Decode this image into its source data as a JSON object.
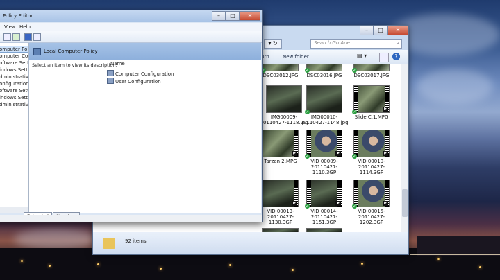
{
  "desktop": {},
  "explorer": {
    "search_placeholder": "Search Go Ape",
    "toolbar": {
      "burn_label": "urn",
      "new_folder_label": "New folder"
    },
    "caption": {
      "minimize": "–",
      "maximize": "□",
      "close": "✕"
    },
    "refresh_glyph": "▾ ↻",
    "search_glyph": "⌕",
    "view_glyph": "▤ ▾",
    "help_glyph": "?",
    "files": [
      {
        "label": "DSC03012.JPG",
        "thumb": "photo"
      },
      {
        "label": "DSC03016.JPG",
        "thumb": "photo"
      },
      {
        "label": "DSC03017.JPG",
        "thumb": "photo"
      },
      {
        "label": "IMG00009-20110427-1118.jpg",
        "thumb": "photo"
      },
      {
        "label": "IMG00010-20110427-1148.jpg",
        "thumb": "photo"
      },
      {
        "label": "Slide C.1.MPG",
        "thumb": "video"
      },
      {
        "label": "Tarzan 2.MPG",
        "thumb": "video"
      },
      {
        "label": "VID 00009-20110427-1110.3GP",
        "thumb": "video"
      },
      {
        "label": "VID 00010-20110427-1114.3GP",
        "thumb": "video"
      },
      {
        "label": "VID 00013-20110427-1130.3GP",
        "thumb": "video"
      },
      {
        "label": "VID 00014-20110427-1151.3GP",
        "thumb": "video"
      },
      {
        "label": "VID 00015-20110427-1202.3GP",
        "thumb": "video"
      }
    ],
    "status": {
      "items": "92 items"
    }
  },
  "gpe": {
    "title": "Policy Editor",
    "caption": {
      "minimize": "–",
      "maximize": "□",
      "close": "✕"
    },
    "menu": {
      "view": "View",
      "help": "Help"
    },
    "tree": [
      "omputer Policy",
      "omputer Configura",
      "oftware Settings",
      "indows Setting",
      "dministrative Te",
      "onfiguration",
      "oftware Settings",
      "indows Setting",
      "dministrative Te"
    ],
    "header_title": "Local Computer Policy",
    "description": "Select an item to view its description.",
    "column_name": "Name",
    "items": [
      "Computer Configuration",
      "User Configuration"
    ],
    "tabs": [
      "Extended",
      "Standard"
    ]
  }
}
